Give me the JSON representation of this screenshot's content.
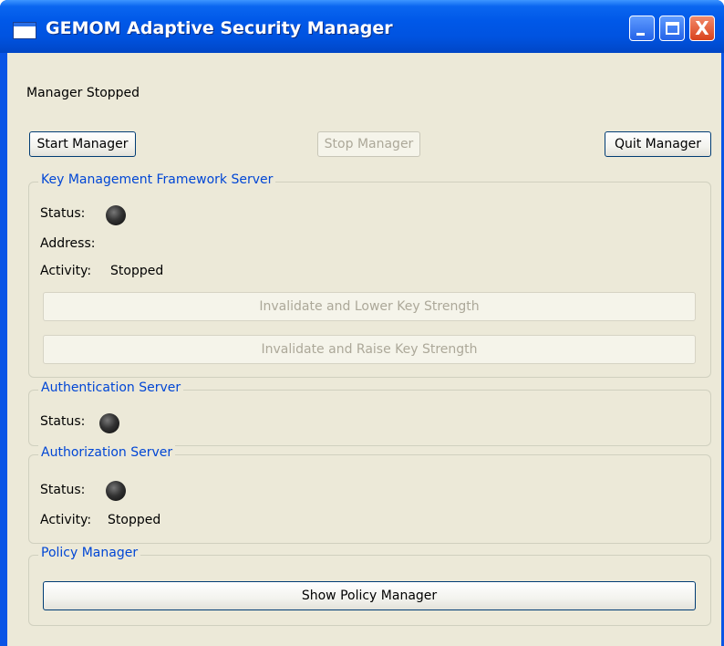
{
  "window": {
    "title": "GEMOM Adaptive Security Manager",
    "close_glyph": "X"
  },
  "manager": {
    "status_text": "Manager Stopped"
  },
  "toolbar": {
    "start_label": "Start Manager",
    "stop_label": "Stop Manager",
    "quit_label": "Quit Manager"
  },
  "kmf": {
    "title": "Key Management Framework Server",
    "status_label": "Status:",
    "address_label": "Address:",
    "address_value": "",
    "activity_label": "Activity:",
    "activity_value": "Stopped",
    "lower_label": "Invalidate and Lower Key Strength",
    "raise_label": "Invalidate and Raise Key Strength"
  },
  "auth": {
    "title": "Authentication Server",
    "status_label": "Status:"
  },
  "authz": {
    "title": "Authorization Server",
    "status_label": "Status:",
    "activity_label": "Activity:",
    "activity_value": "Stopped"
  },
  "policy": {
    "title": "Policy Manager",
    "show_label": "Show Policy Manager"
  },
  "colors": {
    "titlebar": "#0058e8",
    "window_bg": "#ece9d8",
    "group_title": "#0046d5",
    "status_led": "#222222",
    "disabled_text": "#aca899"
  }
}
